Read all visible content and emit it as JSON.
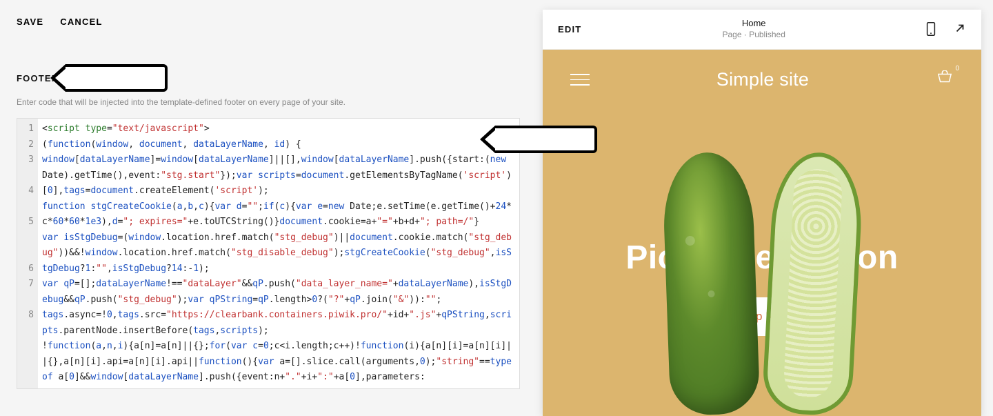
{
  "actions": {
    "save": "SAVE",
    "cancel": "CANCEL"
  },
  "section": {
    "title": "FOOTER",
    "description": "Enter code that will be injected into the template-defined footer on every page of your site."
  },
  "code": {
    "line_numbers": [
      "1",
      "2",
      "3",
      "",
      "4",
      "",
      "5",
      "",
      "",
      "6",
      "7",
      "",
      "8",
      ""
    ],
    "lines_plain": [
      "<script type=\"text/javascript\">",
      "(function(window, document, dataLayerName, id) {",
      "window[dataLayerName]=window[dataLayerName]||[],window[dataLayerName].push({start:(new Date).getTime(),event:\"stg.start\"});var scripts=document.getElementsByTagName('script')[0],tags=document.createElement('script');",
      "function stgCreateCookie(a,b,c){var d=\"\";if(c){var e=new Date;e.setTime(e.getTime()+24*c*60*60*1e3),d=\"; expires=\"+e.toUTCString()}document.cookie=a+\"=\"+b+d+\"; path=/\"}",
      "var isStgDebug=(window.location.href.match(\"stg_debug\")||document.cookie.match(\"stg_debug\"))&&!window.location.href.match(\"stg_disable_debug\");stgCreateCookie(\"stg_debug\",isStgDebug?1:\"\",isStgDebug?14:-1);",
      "var qP=[];dataLayerName!==\"dataLayer\"&&qP.push(\"data_layer_name=\"+dataLayerName),isStgDebug&&qP.push(\"stg_debug\");var qPString=qP.length>0?(\"?\"+qP.join(\"&\")):\"\";",
      "tags.async=!0,tags.src=\"https://clearbank.containers.piwik.pro/\"+id+\".js\"+qPString,scripts.parentNode.insertBefore(tags,scripts);",
      "!function(a,n,i){a[n]=a[n]||{};for(var c=0;c<i.length;c++)!function(i){a[n][i]=a[n][i]||{},a[n][i].api=a[n][i].api||function(){var a=[].slice.call(arguments,0);\"string\"==typeof a[0]&&window[dataLayerName].push({event:n+\".\"+i+\":\"+a[0],parameters:"
    ]
  },
  "preview": {
    "edit": "EDIT",
    "page_name": "Home",
    "page_status": "Page · Published",
    "site_name": "Simple site",
    "cart_count": "0",
    "hero_title": "Pickle Perfection",
    "cta": "Shop Now"
  },
  "colors": {
    "accent": "#dcb56e",
    "cta_text": "#d46b3b"
  }
}
